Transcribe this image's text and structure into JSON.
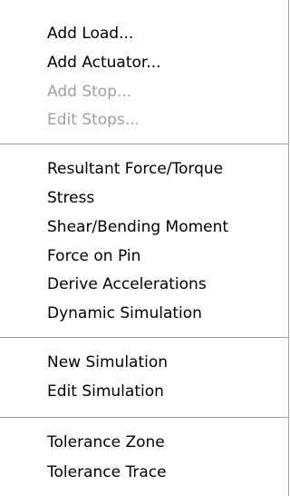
{
  "menu": {
    "groups": [
      {
        "items": [
          {
            "label": "Add Load...",
            "enabled": true
          },
          {
            "label": "Add Actuator...",
            "enabled": true
          },
          {
            "label": "Add Stop...",
            "enabled": false
          },
          {
            "label": "Edit Stops...",
            "enabled": false
          }
        ]
      },
      {
        "items": [
          {
            "label": "Resultant Force/Torque",
            "enabled": true
          },
          {
            "label": "Stress",
            "enabled": true
          },
          {
            "label": "Shear/Bending Moment",
            "enabled": true
          },
          {
            "label": "Force on Pin",
            "enabled": true
          },
          {
            "label": "Derive Accelerations",
            "enabled": true
          },
          {
            "label": "Dynamic Simulation",
            "enabled": true
          }
        ]
      },
      {
        "items": [
          {
            "label": "New Simulation",
            "enabled": true
          },
          {
            "label": "Edit Simulation",
            "enabled": true
          }
        ]
      },
      {
        "items": [
          {
            "label": "Tolerance Zone",
            "enabled": true
          },
          {
            "label": "Tolerance Trace",
            "enabled": true
          }
        ]
      }
    ],
    "colors": {
      "enabled_text": "#000000",
      "disabled_text": "#a0a0a0",
      "separator": "#a0a0a0",
      "background": "#ffffff"
    }
  }
}
